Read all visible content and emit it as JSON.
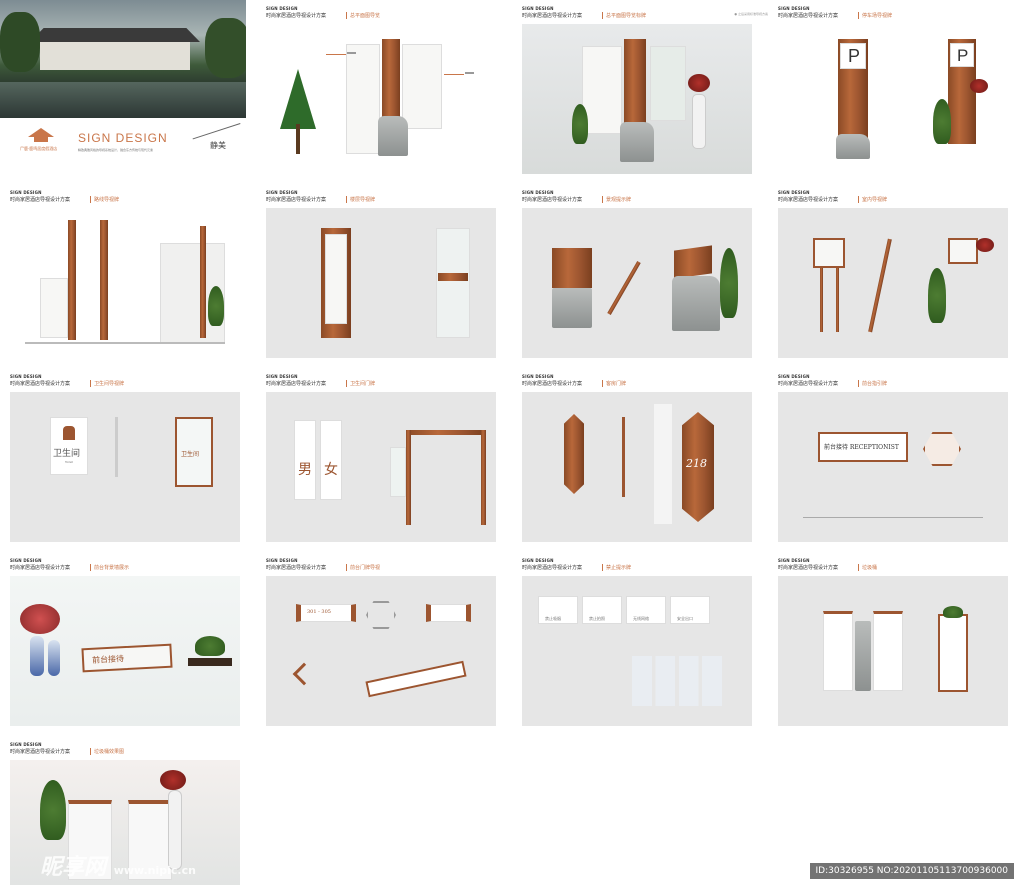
{
  "cover": {
    "title": "SIGN DESIGN",
    "logo_text": "尸鹿·鹿鸣居度假酒店",
    "subtitle": "精致典雅风格的导视系统设计，融合东方传统与现代元素",
    "calligraphy": "静美"
  },
  "header": {
    "brand": "SIGN DESIGN",
    "project": "时尚家居酒店导视设计方案",
    "right_note": "● 之后采用标准导视方案"
  },
  "panels": [
    {
      "section": "总平面图导览"
    },
    {
      "section": "总平面图导览标牌"
    },
    {
      "section": "停车场导视牌"
    },
    {
      "section": "路线导视牌"
    },
    {
      "section": "楼层导视牌"
    },
    {
      "section": "景观提示牌"
    },
    {
      "section": "室内导视牌"
    },
    {
      "section": "卫生间导视牌"
    },
    {
      "section": "卫生间门牌"
    },
    {
      "section": "客房门牌"
    },
    {
      "section": "前台指引牌"
    },
    {
      "section": "前台背景墙展示"
    },
    {
      "section": "前台门牌导视"
    },
    {
      "section": "禁止提示牌"
    },
    {
      "section": "垃圾桶"
    },
    {
      "section": "垃圾桶效果图"
    }
  ],
  "signs": {
    "parking_letter": "P",
    "toilet_cn": "卫生间",
    "toilet_en": "Toilet",
    "toilet_side": "卫生间",
    "male": "男",
    "female": "女",
    "room_number": "218",
    "reception": "前台接待 RECEPTIONIST",
    "reception_side": "前台接待",
    "forbid_1": "禁止吸烟",
    "forbid_2": "禁止拍照",
    "forbid_3": "无线网络",
    "forbid_4": "安全出口",
    "floor_numbers": "301 - 305"
  },
  "watermark": {
    "brand": "昵享网",
    "url": "www.nipic.cn"
  },
  "image_id": "ID:30326955 NO:20201105113700936000",
  "colors": {
    "accent": "#c9764a",
    "wood": "#9c5530",
    "panel_bg": "#e6e6e6"
  }
}
